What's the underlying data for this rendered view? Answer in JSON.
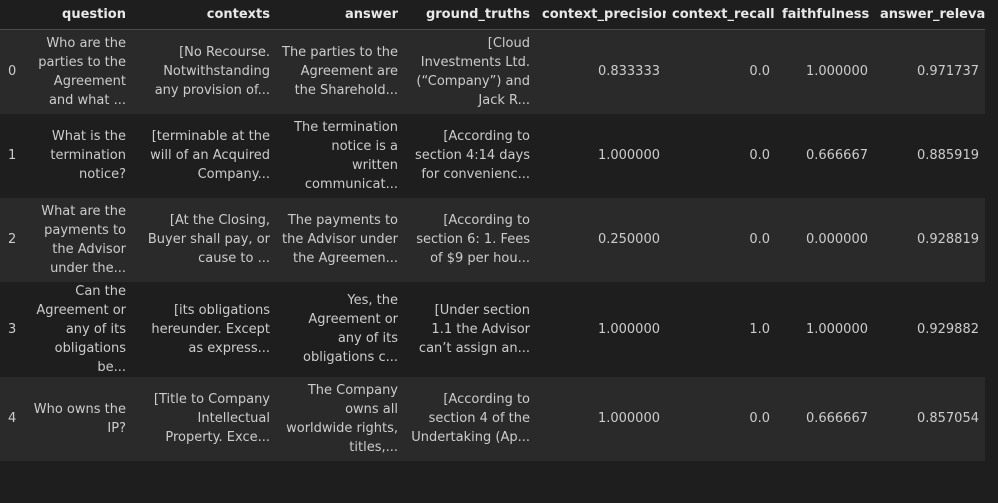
{
  "table": {
    "columns": [
      "",
      "question",
      "contexts",
      "answer",
      "ground_truths",
      "context_precision",
      "context_recall",
      "faithfulness",
      "answer_relevancy"
    ],
    "rows": [
      {
        "index": "0",
        "question": "Who are the parties to the Agreement and what ...",
        "contexts": "[No Recourse. Notwithstanding any provision of...",
        "answer": "The parties to the Agreement are the Sharehold...",
        "ground_truths": "[Cloud Investments Ltd. (“Company”) and Jack R...",
        "context_precision": "0.833333",
        "context_recall": "0.0",
        "faithfulness": "1.000000",
        "answer_relevancy": "0.971737"
      },
      {
        "index": "1",
        "question": "What is the termination notice?",
        "contexts": "[terminable at the will of an Acquired Company...",
        "answer": "The termination notice is a written communicat...",
        "ground_truths": "[According to section 4:14 days for convenienc...",
        "context_precision": "1.000000",
        "context_recall": "0.0",
        "faithfulness": "0.666667",
        "answer_relevancy": "0.885919"
      },
      {
        "index": "2",
        "question": "What are the payments to the Advisor under the...",
        "contexts": "[At the Closing, Buyer shall pay, or cause to ...",
        "answer": "The payments to the Advisor under the Agreemen...",
        "ground_truths": "[According to section 6: 1. Fees of $9 per hou...",
        "context_precision": "0.250000",
        "context_recall": "0.0",
        "faithfulness": "0.000000",
        "answer_relevancy": "0.928819"
      },
      {
        "index": "3",
        "question": "Can the Agreement or any of its obligations be...",
        "contexts": "[its obligations hereunder. Except as express...",
        "answer": "Yes, the Agreement or any of its obligations c...",
        "ground_truths": "[Under section 1.1 the Advisor can’t assign an...",
        "context_precision": "1.000000",
        "context_recall": "1.0",
        "faithfulness": "1.000000",
        "answer_relevancy": "0.929882"
      },
      {
        "index": "4",
        "question": "Who owns the IP?",
        "contexts": "[Title to Company Intellectual Property. Exce...",
        "answer": "The Company owns all worldwide rights, titles,...",
        "ground_truths": "[According to section 4 of the Undertaking (Ap...",
        "context_precision": "1.000000",
        "context_recall": "0.0",
        "faithfulness": "0.666667",
        "answer_relevancy": "0.857054"
      }
    ]
  }
}
